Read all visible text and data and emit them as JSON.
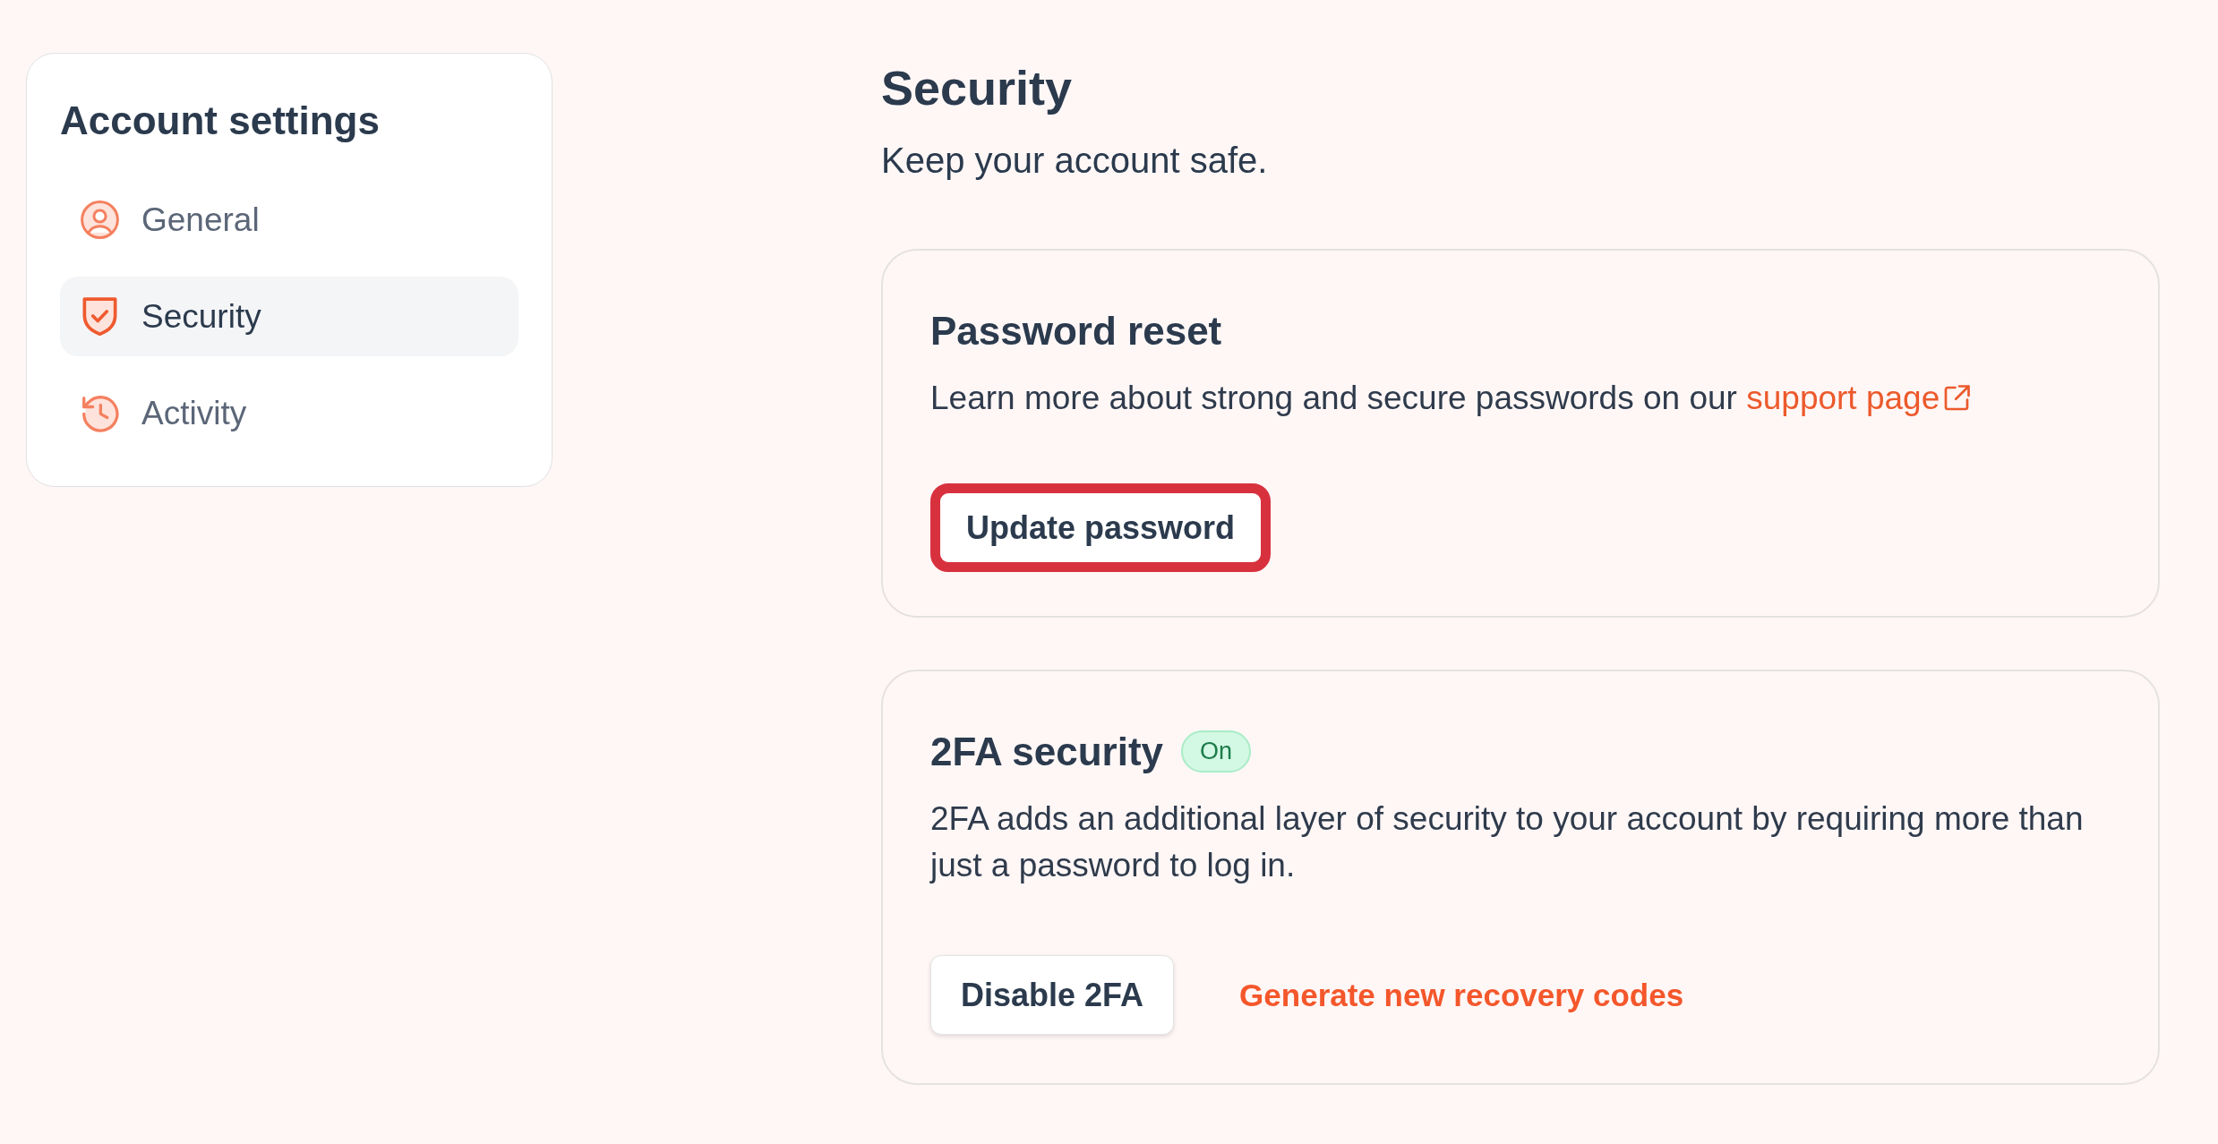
{
  "sidebar": {
    "title": "Account settings",
    "items": [
      {
        "label": "General",
        "selected": false
      },
      {
        "label": "Security",
        "selected": true
      },
      {
        "label": "Activity",
        "selected": false
      }
    ]
  },
  "page": {
    "title": "Security",
    "subtitle": "Keep your account safe."
  },
  "cards": [
    {
      "title": "Password reset",
      "description": "Learn more about strong and secure passwords on our",
      "link": {
        "label": "support page"
      },
      "actions": [
        {
          "kind": "button",
          "label": "Update password",
          "focused": true
        }
      ]
    },
    {
      "title": "2FA security",
      "badge": {
        "label": "On"
      },
      "description": "2FA adds an additional layer of security to your account by requiring more than just a password to log in.",
      "actions": [
        {
          "kind": "button",
          "label": "Disable 2FA",
          "focused": false
        },
        {
          "kind": "link",
          "label": "Generate new recovery codes"
        }
      ]
    }
  ]
}
